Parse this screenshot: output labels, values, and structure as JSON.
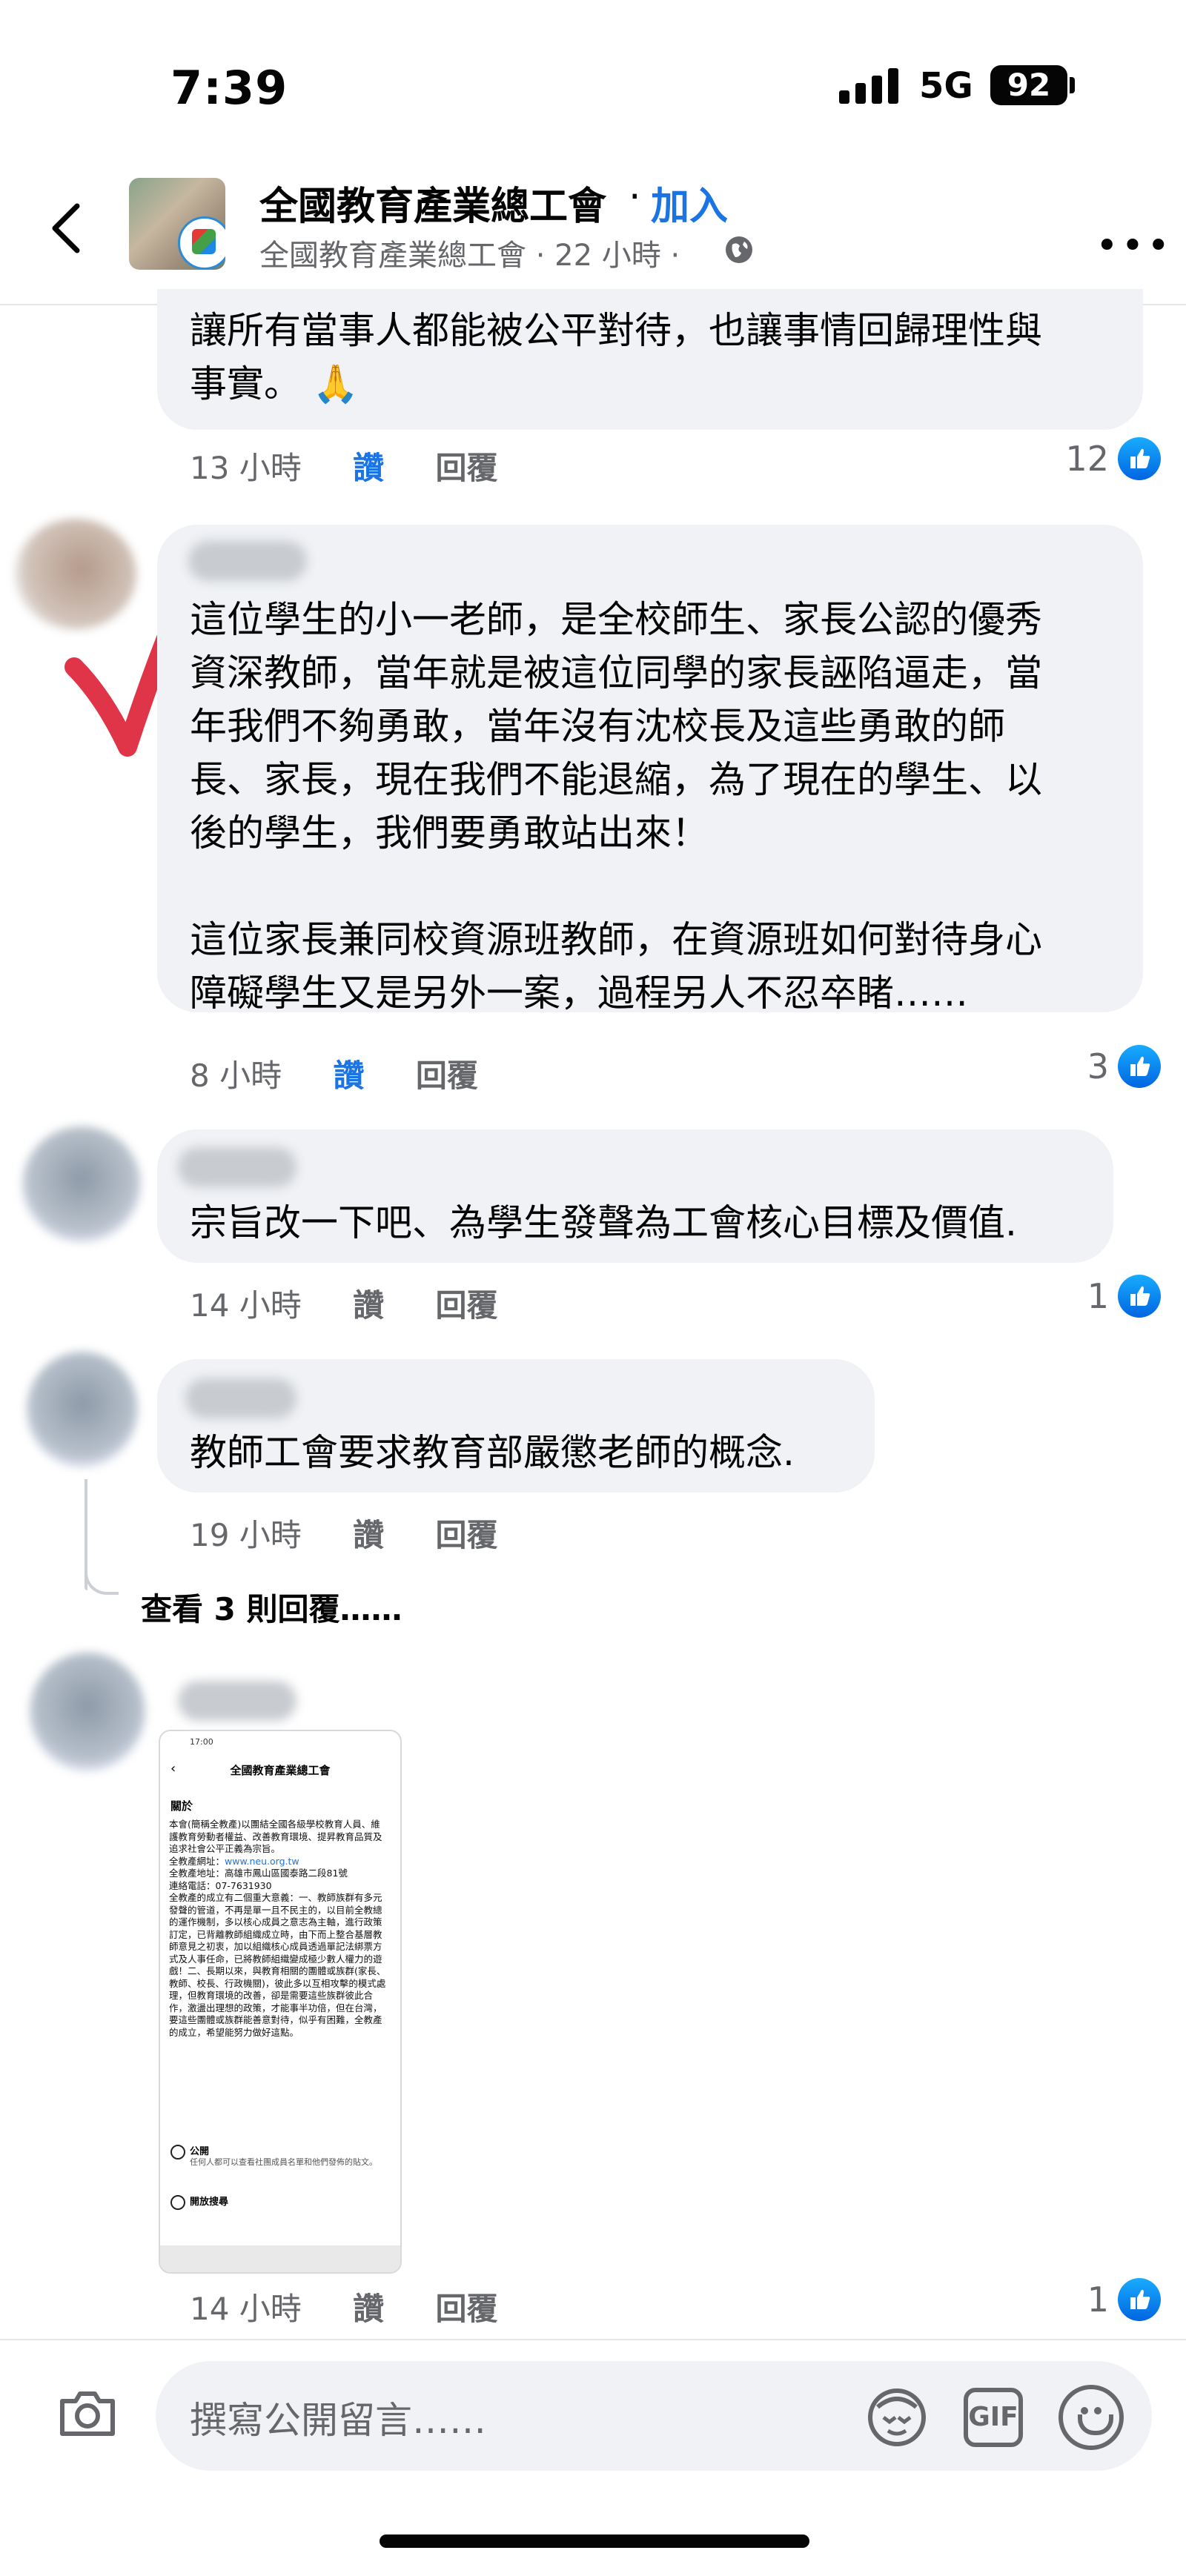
{
  "status_bar": {
    "time": "7:39",
    "network": "5G",
    "battery": "92"
  },
  "header": {
    "page_name": "全國教育產業總工會",
    "dot": "·",
    "join_label": "加入",
    "subline": "全國教育產業總工會 · 22 小時 ·"
  },
  "comments": [
    {
      "text": "讓所有當事人都能被公平對待，也讓事情回歸理性與\n事實。 🙏",
      "time": "13 小時",
      "like_label": "讚",
      "reply_label": "回覆",
      "likes": "12"
    },
    {
      "text": "這位學生的小一老師，是全校師生、家長公認的優秀\n資深教師，當年就是被這位同學的家長誣陷逼走，當\n年我們不夠勇敢，當年沒有沈校長及這些勇敢的師\n長、家長，現在我們不能退縮，為了現在的學生、以\n後的學生，我們要勇敢站出來！\n\n這位家長兼同校資源班教師，在資源班如何對待身心\n障礙學生又是另外一案，過程另人不忍卒睹……",
      "time": "8 小時",
      "like_label": "讚",
      "reply_label": "回覆",
      "likes": "3"
    },
    {
      "text": "宗旨改一下吧、為學生發聲為工會核心目標及價值.",
      "time": "14 小時",
      "like_label": "讚",
      "reply_label": "回覆",
      "likes": "1"
    },
    {
      "text": "教師工會要求教育部嚴懲老師的概念.",
      "time": "19 小時",
      "like_label": "讚",
      "reply_label": "回覆"
    },
    {
      "time": "14 小時",
      "like_label": "讚",
      "reply_label": "回覆",
      "likes": "1"
    }
  ],
  "view_replies": "查看 3 則回覆……",
  "embedded_screenshot": {
    "status": "17:00",
    "title": "全國教育產業總工會",
    "heading": "關於",
    "body_1": "本會(簡稱全教產)以團結全國各級學校教育人員、維護教育勞動者權益、改善教育環境、提昇教育品質及追求社會公平正義為宗旨。\n全教產網址：",
    "url": "www.neu.org.tw",
    "body_2": "\n全教產地址：高雄市鳳山區國泰路二段81號\n連絡電話：07-7631930\n全教產的成立有二個重大意義：一、教師族群有多元發聲的管道，不再是單一且不民主的，以目前全教總的運作機制，多以核心成員之意志為主軸，進行政策訂定，已背離教師組織成立時，由下而上整合基層教師意見之初衷，加以組織核心成員透過單記法綁票方式及人事任命，已將教師組織變成極少數人權力的遊戲！二、長期以來，與教育相關的團體或族群(家長、教師、校長、行政機關)，彼此多以互相攻擊的模式處理，但教育環境的改善，卻是需要這些族群彼此合作，激盪出理想的政策，才能事半功倍，但在台灣，要這些團體或族群能善意對待，似乎有困難，全教產的成立，希望能努力做好這點。",
    "public_label": "公開",
    "public_desc": "任何人都可以查看社團成員名單和他們發佈的貼文。",
    "open_label": "開放搜尋"
  },
  "composer": {
    "placeholder": "撰寫公開留言……",
    "gif_label": "GIF"
  },
  "colors": {
    "accent": "#1b74e4",
    "bubble": "#f0f2f5",
    "meta": "#65676b",
    "check": "#e03448"
  },
  "icons": [
    "back-chevron-icon",
    "globe-icon",
    "more-icon",
    "like-thumb-icon",
    "camera-icon",
    "avatar-sticker-icon",
    "gif-icon",
    "emoji-icon"
  ]
}
